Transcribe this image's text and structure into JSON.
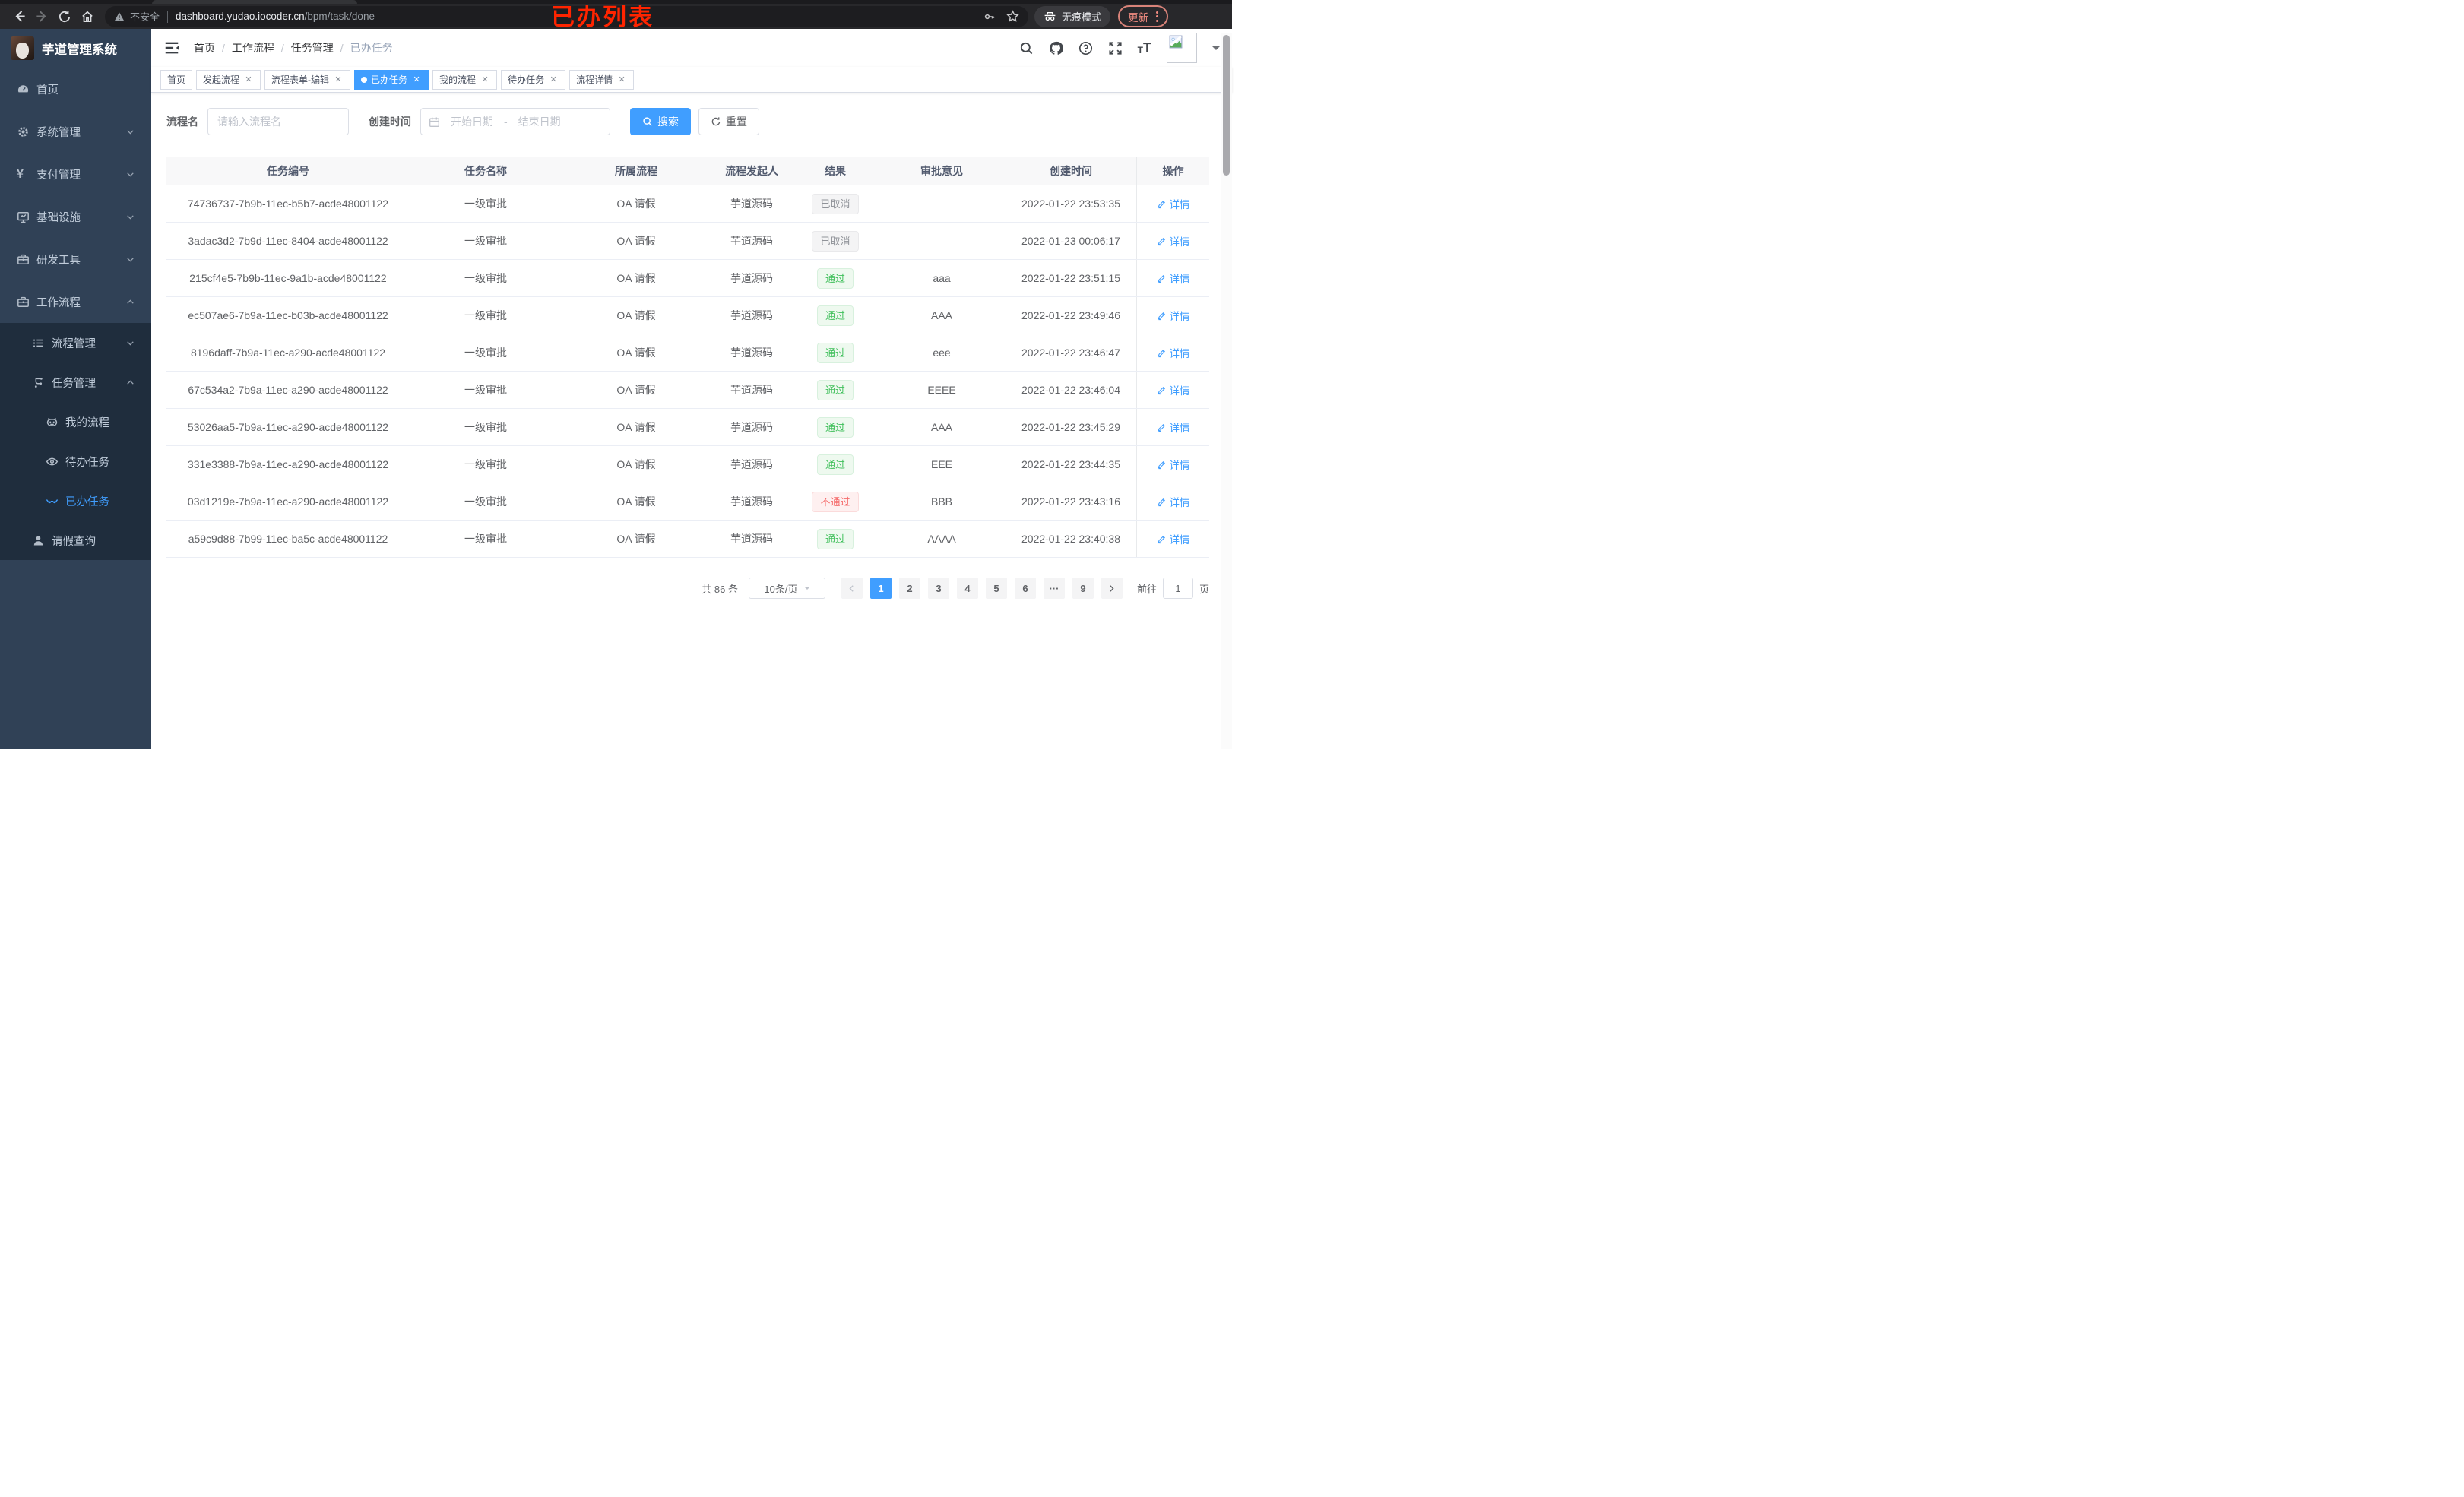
{
  "annotation": "已办列表",
  "browser": {
    "security_label": "不安全",
    "url_host": "dashboard.yudao.iocoder.cn",
    "url_path": "/bpm/task/done",
    "incognito_label": "无痕模式",
    "update_label": "更新"
  },
  "sidebar": {
    "app_title": "芋道管理系统",
    "menu": [
      {
        "label": "首页",
        "icon": "dashboard-icon",
        "level": 0,
        "arrow": "",
        "dark": false,
        "active": false
      },
      {
        "label": "系统管理",
        "icon": "gear-icon",
        "level": 0,
        "arrow": "down",
        "dark": false,
        "active": false
      },
      {
        "label": "支付管理",
        "icon": "yen-icon",
        "level": 0,
        "arrow": "down",
        "dark": false,
        "active": false
      },
      {
        "label": "基础设施",
        "icon": "monitor-icon",
        "level": 0,
        "arrow": "down",
        "dark": false,
        "active": false
      },
      {
        "label": "研发工具",
        "icon": "toolbox-icon",
        "level": 0,
        "arrow": "down",
        "dark": false,
        "active": false
      },
      {
        "label": "工作流程",
        "icon": "briefcase-icon",
        "level": 0,
        "arrow": "up",
        "dark": false,
        "active": false
      },
      {
        "label": "流程管理",
        "icon": "list-icon",
        "level": 1,
        "arrow": "down",
        "dark": true,
        "active": false
      },
      {
        "label": "任务管理",
        "icon": "tree-icon",
        "level": 1,
        "arrow": "up",
        "dark": true,
        "active": false
      },
      {
        "label": "我的流程",
        "icon": "robot-icon",
        "level": 2,
        "arrow": "",
        "dark": true,
        "active": false
      },
      {
        "label": "待办任务",
        "icon": "eye-icon",
        "level": 2,
        "arrow": "",
        "dark": true,
        "active": false
      },
      {
        "label": "已办任务",
        "icon": "glasses-icon",
        "level": 2,
        "arrow": "",
        "dark": true,
        "active": true
      },
      {
        "label": "请假查询",
        "icon": "user-icon",
        "level": 1,
        "arrow": "",
        "dark": true,
        "active": false
      }
    ]
  },
  "breadcrumb": [
    "首页",
    "工作流程",
    "任务管理",
    "已办任务"
  ],
  "tabs": [
    {
      "label": "首页",
      "closable": false,
      "active": false
    },
    {
      "label": "发起流程",
      "closable": true,
      "active": false
    },
    {
      "label": "流程表单-编辑",
      "closable": true,
      "active": false
    },
    {
      "label": "已办任务",
      "closable": true,
      "active": true
    },
    {
      "label": "我的流程",
      "closable": true,
      "active": false
    },
    {
      "label": "待办任务",
      "closable": true,
      "active": false
    },
    {
      "label": "流程详情",
      "closable": true,
      "active": false
    }
  ],
  "filter": {
    "name_label": "流程名",
    "name_placeholder": "请输入流程名",
    "time_label": "创建时间",
    "start_placeholder": "开始日期",
    "range_separator": "-",
    "end_placeholder": "结束日期",
    "search_label": "搜索",
    "reset_label": "重置"
  },
  "table": {
    "columns": [
      "任务编号",
      "任务名称",
      "所属流程",
      "流程发起人",
      "结果",
      "审批意见",
      "创建时间",
      "操作"
    ],
    "detail_label": "详情",
    "rows": [
      {
        "id": "74736737-7b9b-11ec-b5b7-acde48001122",
        "name": "一级审批",
        "flow": "OA 请假",
        "starter": "芋道源码",
        "result": "已取消",
        "result_type": "info",
        "comment": "",
        "time": "2022-01-22 23:53:35"
      },
      {
        "id": "3adac3d2-7b9d-11ec-8404-acde48001122",
        "name": "一级审批",
        "flow": "OA 请假",
        "starter": "芋道源码",
        "result": "已取消",
        "result_type": "info",
        "comment": "",
        "time": "2022-01-23 00:06:17"
      },
      {
        "id": "215cf4e5-7b9b-11ec-9a1b-acde48001122",
        "name": "一级审批",
        "flow": "OA 请假",
        "starter": "芋道源码",
        "result": "通过",
        "result_type": "success",
        "comment": "aaa",
        "time": "2022-01-22 23:51:15"
      },
      {
        "id": "ec507ae6-7b9a-11ec-b03b-acde48001122",
        "name": "一级审批",
        "flow": "OA 请假",
        "starter": "芋道源码",
        "result": "通过",
        "result_type": "success",
        "comment": "AAA",
        "time": "2022-01-22 23:49:46"
      },
      {
        "id": "8196daff-7b9a-11ec-a290-acde48001122",
        "name": "一级审批",
        "flow": "OA 请假",
        "starter": "芋道源码",
        "result": "通过",
        "result_type": "success",
        "comment": "eee",
        "time": "2022-01-22 23:46:47"
      },
      {
        "id": "67c534a2-7b9a-11ec-a290-acde48001122",
        "name": "一级审批",
        "flow": "OA 请假",
        "starter": "芋道源码",
        "result": "通过",
        "result_type": "success",
        "comment": "EEEE",
        "time": "2022-01-22 23:46:04"
      },
      {
        "id": "53026aa5-7b9a-11ec-a290-acde48001122",
        "name": "一级审批",
        "flow": "OA 请假",
        "starter": "芋道源码",
        "result": "通过",
        "result_type": "success",
        "comment": "AAA",
        "time": "2022-01-22 23:45:29"
      },
      {
        "id": "331e3388-7b9a-11ec-a290-acde48001122",
        "name": "一级审批",
        "flow": "OA 请假",
        "starter": "芋道源码",
        "result": "通过",
        "result_type": "success",
        "comment": "EEE",
        "time": "2022-01-22 23:44:35"
      },
      {
        "id": "03d1219e-7b9a-11ec-a290-acde48001122",
        "name": "一级审批",
        "flow": "OA 请假",
        "starter": "芋道源码",
        "result": "不通过",
        "result_type": "danger",
        "comment": "BBB",
        "time": "2022-01-22 23:43:16"
      },
      {
        "id": "a59c9d88-7b99-11ec-ba5c-acde48001122",
        "name": "一级审批",
        "flow": "OA 请假",
        "starter": "芋道源码",
        "result": "通过",
        "result_type": "success",
        "comment": "AAAA",
        "time": "2022-01-22 23:40:38"
      }
    ]
  },
  "pagination": {
    "total_label": "共 86 条",
    "page_size": "10条/页",
    "pages": [
      "1",
      "2",
      "3",
      "4",
      "5",
      "6",
      "···",
      "9"
    ],
    "active_page": "1",
    "jump_prefix": "前往",
    "jump_value": "1",
    "jump_suffix": "页"
  },
  "colors": {
    "accent": "#409eff",
    "sidebar_bg": "#304156",
    "submenu_bg": "#1f2d3d",
    "sidebar_text": "#bfcbd9",
    "success_text": "#41c05c",
    "danger_text": "#f56c6c",
    "info_text": "#909399",
    "annotation_red": "#ff2400"
  }
}
